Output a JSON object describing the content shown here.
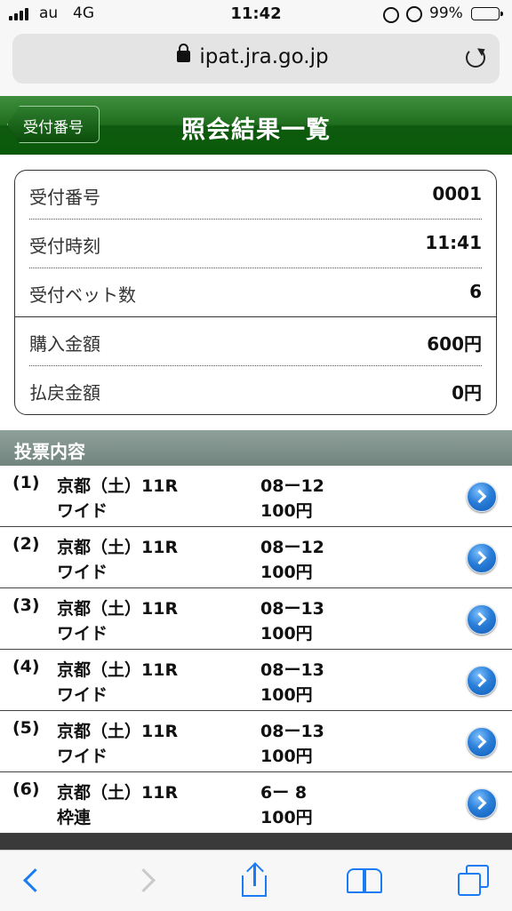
{
  "status": {
    "carrier": "au",
    "network": "4G",
    "time": "11:42",
    "battery_pct": "99%"
  },
  "browser": {
    "url": "ipat.jra.go.jp"
  },
  "header": {
    "back_label": "受付番号",
    "title": "照会結果一覧",
    "color": "#1f6f1f"
  },
  "summary": [
    {
      "label": "受付番号",
      "value": "0001"
    },
    {
      "label": "受付時刻",
      "value": "11:41"
    },
    {
      "label": "受付ベット数",
      "value": "6"
    },
    {
      "label": "購入金額",
      "value": "600円"
    },
    {
      "label": "払戻金額",
      "value": "0円"
    }
  ],
  "section_title": "投票内容",
  "bets": [
    {
      "num": "(1)",
      "race": "京都（土）11R",
      "type": "ワイド",
      "combo": "08ー12",
      "amount": "100円"
    },
    {
      "num": "(2)",
      "race": "京都（土）11R",
      "type": "ワイド",
      "combo": "08ー12",
      "amount": "100円"
    },
    {
      "num": "(3)",
      "race": "京都（土）11R",
      "type": "ワイド",
      "combo": "08ー13",
      "amount": "100円"
    },
    {
      "num": "(4)",
      "race": "京都（土）11R",
      "type": "ワイド",
      "combo": "08ー13",
      "amount": "100円"
    },
    {
      "num": "(5)",
      "race": "京都（土）11R",
      "type": "ワイド",
      "combo": "08ー13",
      "amount": "100円"
    },
    {
      "num": "(6)",
      "race": "京都（土）11R",
      "type": "枠連",
      "combo": "6ー 8",
      "amount": "100円"
    }
  ],
  "toolbar": {
    "icons": [
      "back-icon",
      "forward-icon",
      "share-icon",
      "bookmarks-icon",
      "tabs-icon"
    ],
    "accent": "#1a7cf5"
  }
}
